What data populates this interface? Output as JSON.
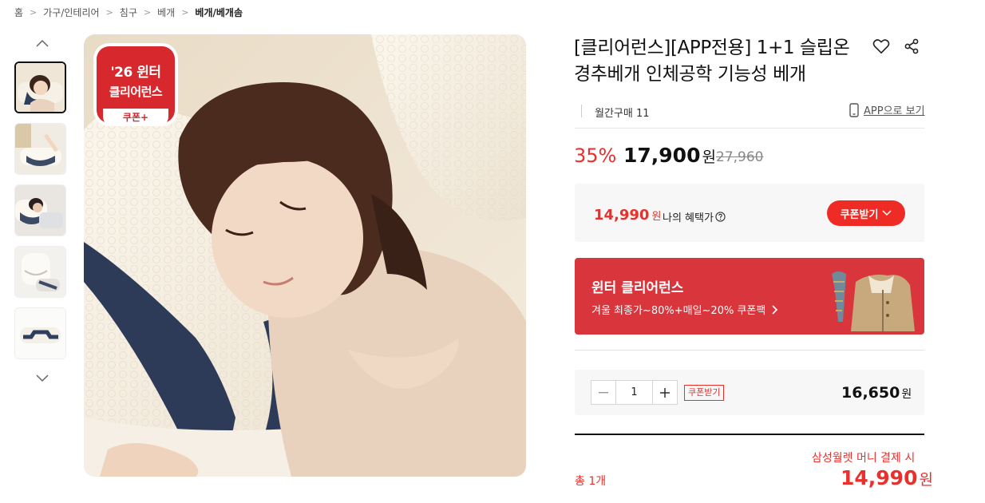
{
  "breadcrumb": [
    "홈",
    "가구/인테리어",
    "침구",
    "베개",
    "베개/베개솜"
  ],
  "image_badge": {
    "line1": "'26 윈터",
    "line2": "클리어런스",
    "line3": "쿠폰+"
  },
  "product": {
    "title": "[클리어런스][APP전용] 1+1 슬립온 경추베개 인체공학 기능성 베개",
    "monthly_purchases": "월간구매 11",
    "app_link": "APP으로 보기"
  },
  "price": {
    "discount": "35%",
    "sale": "17,900",
    "won": "원",
    "original": "27,960"
  },
  "benefit": {
    "price": "14,990",
    "won": "원",
    "label": "나의 혜택가",
    "coupon_button": "쿠폰받기"
  },
  "promo": {
    "title": "윈터 클리어런스",
    "subtitle": "겨울 최종가~80%+매일~20% 쿠폰팩"
  },
  "order": {
    "quantity": "1",
    "coupon_tag": "쿠폰받기",
    "line_price": "16,650",
    "won": "원"
  },
  "summary": {
    "total_count": "총 1개",
    "payment_note": "삼성월렛 머니 결제 시",
    "total_price": "14,990",
    "won": "원"
  },
  "colors": {
    "accent": "#e8302c",
    "promo_bg": "#d8363c",
    "badge": "#d7292d"
  }
}
